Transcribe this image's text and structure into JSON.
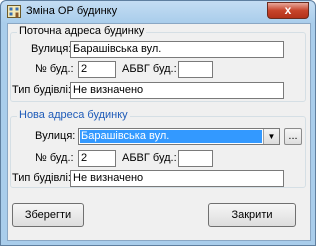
{
  "window": {
    "title": "Зміна ОР будинку",
    "close_label": "x",
    "icon": "building-icon"
  },
  "current_address": {
    "group_title": "Поточна адреса будинку",
    "street_label": "Вулиця:",
    "street_value": "Барашівська вул.",
    "house_no_label": "№ буд.:",
    "house_no_value": "2",
    "letter_label": "АБВГ буд.:",
    "letter_value": "",
    "building_type_label": "Тип будівлі:",
    "building_type_value": "Не визначено"
  },
  "new_address": {
    "group_title": "Нова адреса будинку",
    "street_label": "Вулиця:",
    "street_value": "Барашівська вул.",
    "browse_label": "...",
    "house_no_label": "№ буд.:",
    "house_no_value": "2",
    "letter_label": "АБВГ буд.:",
    "letter_value": "",
    "building_type_label": "Тип будівлі:",
    "building_type_value": "Не визначено"
  },
  "buttons": {
    "save_label": "Зберегти",
    "close_label": "Закрити"
  }
}
